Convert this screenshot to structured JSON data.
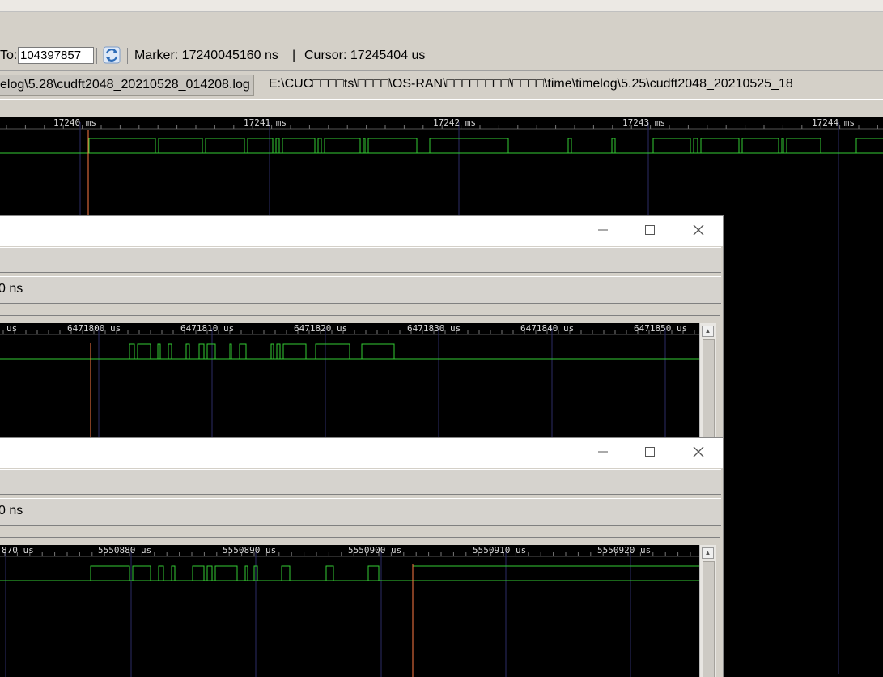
{
  "toolbar": {
    "to_label": "To:",
    "to_value": "104397857",
    "marker": "Marker: 17240045160 ns",
    "separator": "|",
    "cursor": "Cursor: 17245404 us"
  },
  "files": {
    "tab_active": "elog\\5.28\\cudft2048_20210528_014208.log",
    "tab_other": "E:\\CUC□□□□ts\\□□□□\\OS-RAN\\□□□□□□□□\\□□□□\\time\\timelog\\5.25\\cudft2048_20210525_18"
  },
  "main_wave": {
    "ticks": [
      "17240 ms",
      "17241 ms",
      "17242 ms",
      "17243 ms",
      "17244 ms"
    ]
  },
  "window1": {
    "status": "0 ns",
    "ticks": [
      "us",
      "6471800 us",
      "6471810 us",
      "6471820 us",
      "6471830 us",
      "6471840 us",
      "6471850 us"
    ]
  },
  "window2": {
    "status": "0 ns",
    "ticks": [
      "870 us",
      "5550880 us",
      "5550890 us",
      "5550900 us",
      "5550910 us",
      "5550920 us"
    ]
  },
  "icons": {
    "refresh": "refresh-icon",
    "minimize": "minimize-icon",
    "maximize": "maximize-icon",
    "close": "close-icon"
  },
  "colors": {
    "signal": "#33cc33",
    "marker": "#ff7a45",
    "grid": "#2b2b66",
    "background": "#000000",
    "chrome": "#d4d0c8"
  }
}
